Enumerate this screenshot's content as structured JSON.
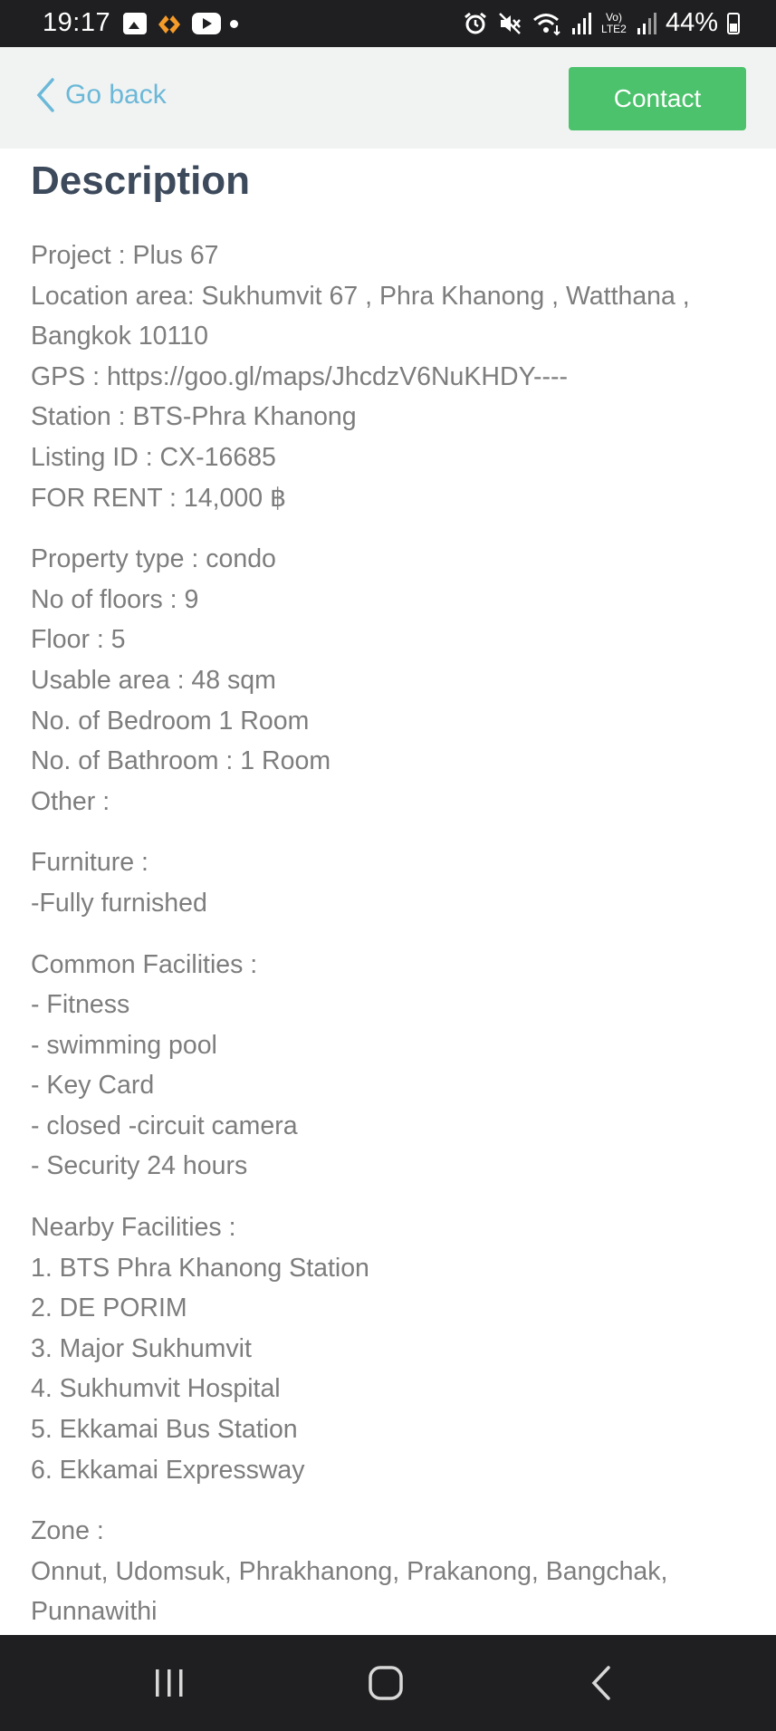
{
  "status_bar": {
    "time": "19:17",
    "battery_percent": "44%",
    "signal_label": "Vo) LTE2",
    "icons": [
      "gallery-icon",
      "app-notification-icon",
      "youtube-icon",
      "notification-dot-icon",
      "alarm-icon",
      "mute-icon",
      "wifi-icon",
      "signal-icon",
      "battery-icon"
    ]
  },
  "header": {
    "back_label": "Go back",
    "contact_label": "Contact",
    "accent_color": "#4bc26b",
    "link_color": "#6bb8d8"
  },
  "description": {
    "title": "Description",
    "overview": [
      "Project : Plus 67",
      "Location area: Sukhumvit 67 , Phra Khanong , Watthana ,",
      "Bangkok 10110",
      "GPS : https://goo.gl/maps/JhcdzV6NuKHDY----",
      "Station : BTS-Phra Khanong",
      "Listing ID : CX-16685",
      "FOR RENT : 14,000 ฿"
    ],
    "property": [
      "Property type : condo",
      "No of floors : 9",
      "Floor : 5",
      "Usable area : 48 sqm",
      "No. of Bedroom 1 Room",
      "No. of Bathroom : 1 Room",
      "Other :"
    ],
    "furniture": [
      "Furniture :",
      "-Fully furnished"
    ],
    "common_facilities": [
      "Common Facilities :",
      "- Fitness",
      "- swimming pool",
      "- Key Card",
      "- closed -circuit camera",
      "- Security 24 hours"
    ],
    "nearby_facilities": [
      "Nearby Facilities :",
      "1. BTS Phra Khanong Station",
      "2. DE PORIM",
      "3. Major Sukhumvit",
      "4. Sukhumvit Hospital",
      "5. Ekkamai Bus Station",
      "6. Ekkamai Expressway"
    ],
    "zone": [
      "Zone :",
      "Onnut, Udomsuk, Phrakhanong, Prakanong, Bangchak,",
      "Punnawithi"
    ]
  },
  "nav_bar": {
    "buttons": [
      "recent-apps-icon",
      "home-icon",
      "back-icon"
    ]
  }
}
